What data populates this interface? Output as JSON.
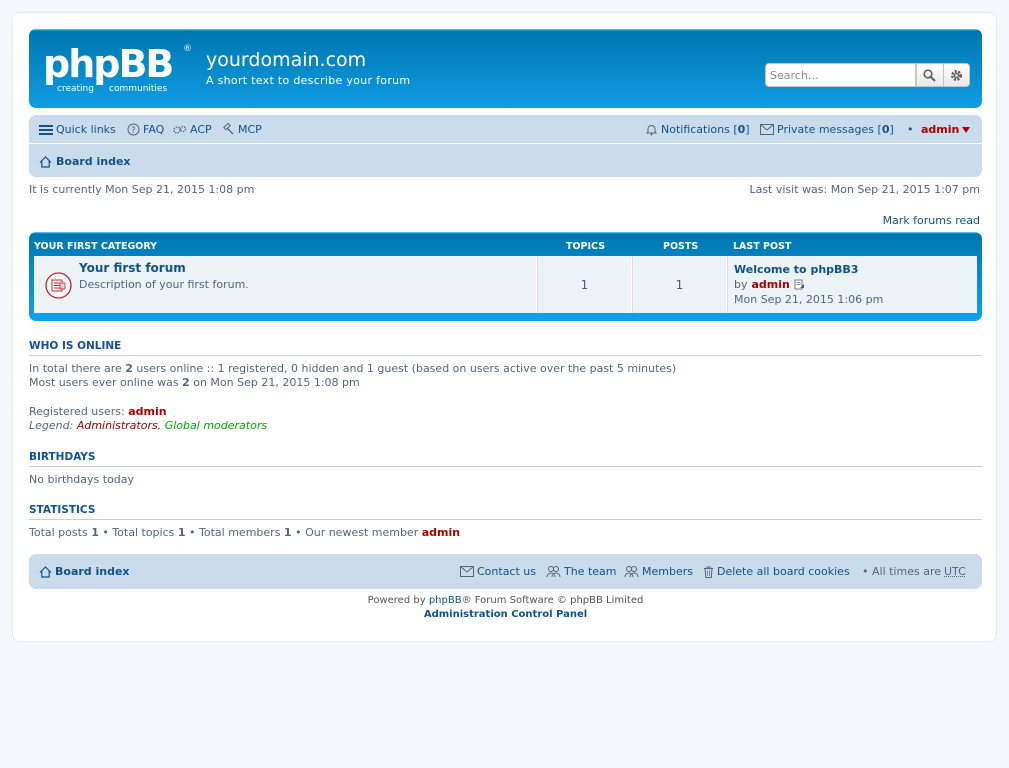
{
  "header": {
    "logo_text": "phpBB",
    "logo_sub": "creating communities",
    "site_title": "yourdomain.com",
    "site_description": "A short text to describe your forum",
    "search_placeholder": "Search…"
  },
  "navbar": {
    "quick_links": "Quick links",
    "faq": "FAQ",
    "acp": "ACP",
    "mcp": "MCP",
    "notifications_label": "Notifications [",
    "notifications_count": "0",
    "notifications_close": "]",
    "pm_label": "Private messages [",
    "pm_count": "0",
    "pm_close": "]",
    "bullet": "•",
    "username": "admin",
    "breadcrumb": "Board index"
  },
  "times": {
    "current": "It is currently Mon Sep 21, 2015 1:08 pm",
    "last_visit": "Last visit was: Mon Sep 21, 2015 1:07 pm",
    "mark_read": "Mark forums read"
  },
  "forum_table": {
    "category": "Your first category",
    "col_topics": "Topics",
    "col_posts": "Posts",
    "col_last_post": "Last post",
    "rows": [
      {
        "title": "Your first forum",
        "description": "Description of your first forum.",
        "topics": "1",
        "posts": "1",
        "last_post_title": "Welcome to phpBB3",
        "last_post_by": "by",
        "last_post_author": "admin",
        "last_post_time": "Mon Sep 21, 2015 1:06 pm"
      }
    ]
  },
  "who_is_online": {
    "heading": "Who is online",
    "line1_a": "In total there are",
    "line1_count": "2",
    "line1_b": "users online :: 1 registered, 0 hidden and 1 guest (based on users active over the past 5 minutes)",
    "line2_a": "Most users ever online was",
    "line2_count": "2",
    "line2_b": "on Mon Sep 21, 2015 1:08 pm",
    "registered_label": "Registered users:",
    "registered_user": "admin",
    "legend_label": "Legend:",
    "legend_admins": "Administrators",
    "legend_sep": ",",
    "legend_gmods": "Global moderators"
  },
  "birthdays": {
    "heading": "Birthdays",
    "text": "No birthdays today"
  },
  "statistics": {
    "heading": "Statistics",
    "posts_label": "Total posts",
    "posts": "1",
    "topics_label": "• Total topics",
    "topics": "1",
    "members_label": "• Total members",
    "members": "1",
    "newest_label": "• Our newest member",
    "newest": "admin"
  },
  "footer": {
    "board_index": "Board index",
    "contact": "Contact us",
    "team": "The team",
    "members": "Members",
    "delete_cookies": "Delete all board cookies",
    "times_label": "• All times are",
    "timezone": "UTC",
    "powered_a": "Powered by",
    "powered_link": "phpBB",
    "powered_b": "® Forum Software © phpBB Limited",
    "acp_link": "Administration Control Panel"
  },
  "colors": {
    "header_blue": "#12a3eb",
    "nav_bg": "#cadceb",
    "link": "#105289",
    "admin_red": "#aa0000",
    "gmod_green": "#00aa00"
  }
}
